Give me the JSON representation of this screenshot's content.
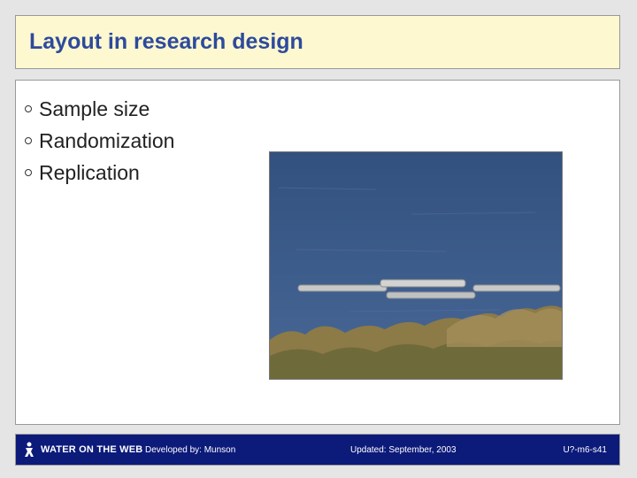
{
  "slide": {
    "title": "Layout in research design",
    "bullets": [
      "Sample size",
      "Randomization",
      "Replication"
    ]
  },
  "photo": {
    "icon": "aquaculture-pens-photo"
  },
  "footer": {
    "logo_text": "WATER ON THE WEB",
    "developed_by": "Developed by: Munson",
    "updated": "Updated: September, 2003",
    "code": "U?-m6-s41"
  },
  "colors": {
    "title": "#2d4a9c",
    "title_bg": "#fdf8d0",
    "footer_bg": "#0c1a7a",
    "page_bg": "#e5e5e5"
  }
}
